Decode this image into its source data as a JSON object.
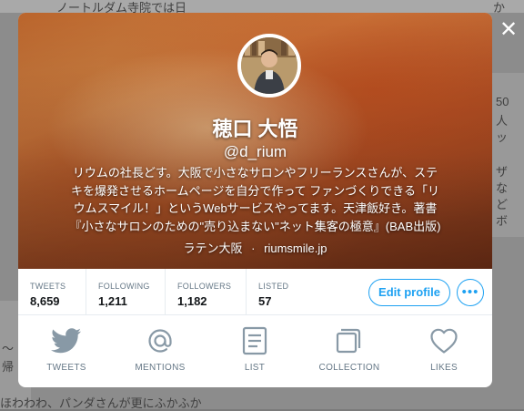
{
  "background": {
    "top_text": "ノートルダム寺院では日",
    "right_top_text": "か",
    "right_text_1": "50",
    "right_text_2": "人",
    "right_text_3": "ッ",
    "right_text_4": "ザ",
    "right_text_5": "な",
    "right_text_6": "ど",
    "right_text_7": "ボ",
    "left_text_1": "〜",
    "left_text_2": "帰",
    "bottom_text": "ほわわわ、パンダさんが更にふかふか"
  },
  "profile": {
    "name": "穂口 大悟",
    "handle": "@d_rium",
    "bio_lines": [
      "リウムの社長どす。大阪で小さなサロンやフリーランスさんが、ステ",
      "キを爆発させるホームページを自分で作って ファンづくりできる「リ",
      "ウムスマイル！」というWebサービスやってます。天津飯好き。著書",
      "『小さなサロンのための\"売り込まない\"ネット集客の極意』(BAB出版)"
    ],
    "location": "ラテン大阪",
    "separator": "·",
    "website": "riumsmile.jp"
  },
  "stats": [
    {
      "label": "TWEETS",
      "value": "8,659"
    },
    {
      "label": "FOLLOWING",
      "value": "1,211"
    },
    {
      "label": "FOLLOWERS",
      "value": "1,182"
    },
    {
      "label": "LISTED",
      "value": "57"
    }
  ],
  "actions": {
    "edit_profile": "Edit profile",
    "more": "•••"
  },
  "nav": [
    {
      "label": "TWEETS",
      "icon": "bird-icon"
    },
    {
      "label": "MENTIONS",
      "icon": "at-icon"
    },
    {
      "label": "LIST",
      "icon": "list-icon"
    },
    {
      "label": "COLLECTION",
      "icon": "collection-icon"
    },
    {
      "label": "LIKES",
      "icon": "heart-icon"
    }
  ],
  "colors": {
    "accent": "#1da1f2",
    "icon": "#8899a6",
    "label": "#657786"
  }
}
